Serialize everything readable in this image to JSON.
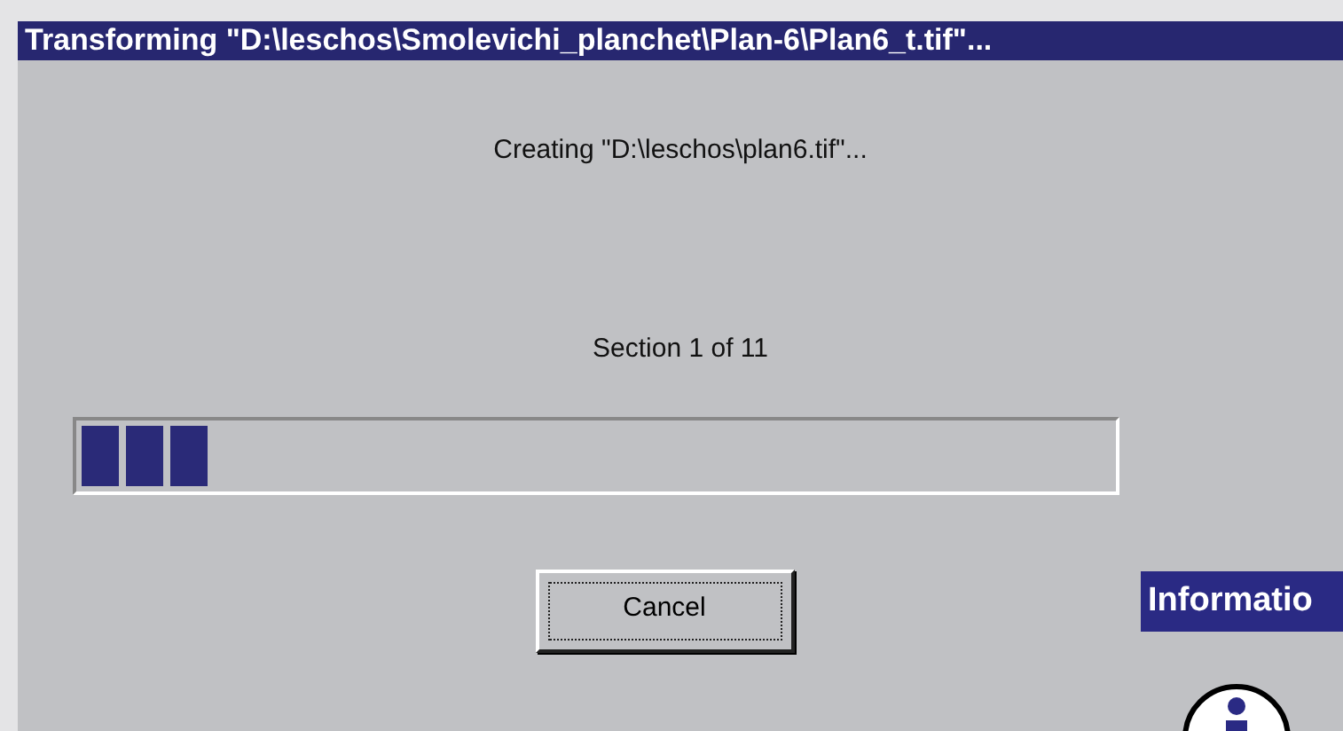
{
  "window": {
    "title": "Transforming \"D:\\leschos\\Smolevichi_planchet\\Plan-6\\Plan6_t.tif\"..."
  },
  "message": "Creating \"D:\\leschos\\plan6.tif\"...",
  "section": "Section 1 of 11",
  "progress": {
    "level": 0.13
  },
  "buttons": [
    {
      "label": "Cancel",
      "focused": true
    }
  ],
  "info_window": {
    "title": "Informatio"
  }
}
